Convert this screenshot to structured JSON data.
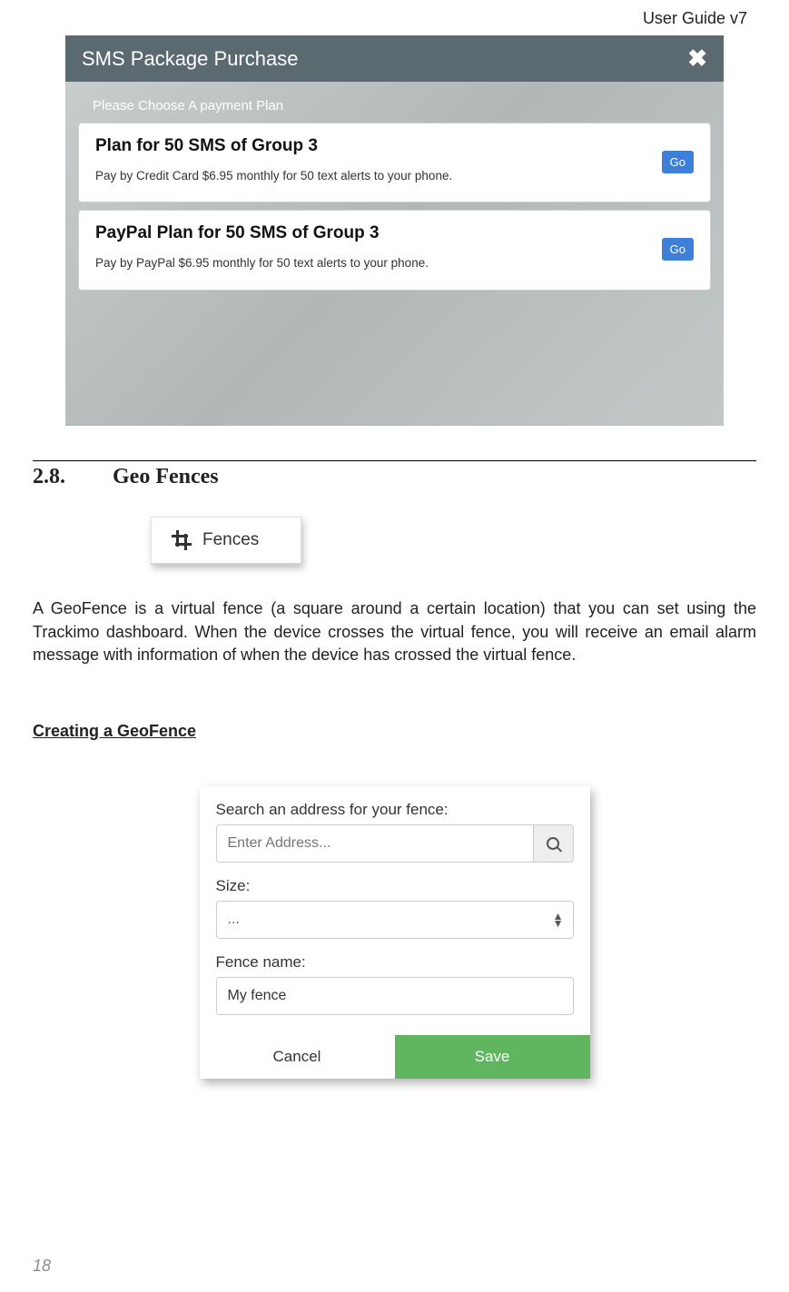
{
  "header": {
    "guide": "User Guide v7"
  },
  "page_number": "18",
  "modal": {
    "title": "SMS Package Purchase",
    "subtitle": "Please Choose A payment Plan",
    "plans": [
      {
        "title": "Plan for 50 SMS of Group 3",
        "desc": "Pay by Credit Card $6.95 monthly for 50 text alerts to your phone.",
        "go": "Go"
      },
      {
        "title": "PayPal Plan for 50 SMS of Group 3",
        "desc": "Pay by PayPal $6.95 monthly for 50 text alerts to your phone.",
        "go": "Go"
      }
    ]
  },
  "section": {
    "num": "2.8.",
    "title": "Geo Fences"
  },
  "fences_button": {
    "label": "Fences"
  },
  "paragraph": "A GeoFence is a virtual fence (a square around a certain location) that you can set using the Trackimo dashboard. When the device crosses the virtual fence, you will receive an email alarm message with information of when the device has crossed the virtual fence.",
  "subheading": "Creating a GeoFence",
  "form": {
    "search_label": "Search an address for your fence:",
    "search_placeholder": "Enter Address...",
    "size_label": "Size:",
    "size_value": "...",
    "name_label": "Fence name:",
    "name_value": "My fence",
    "cancel": "Cancel",
    "save": "Save"
  }
}
